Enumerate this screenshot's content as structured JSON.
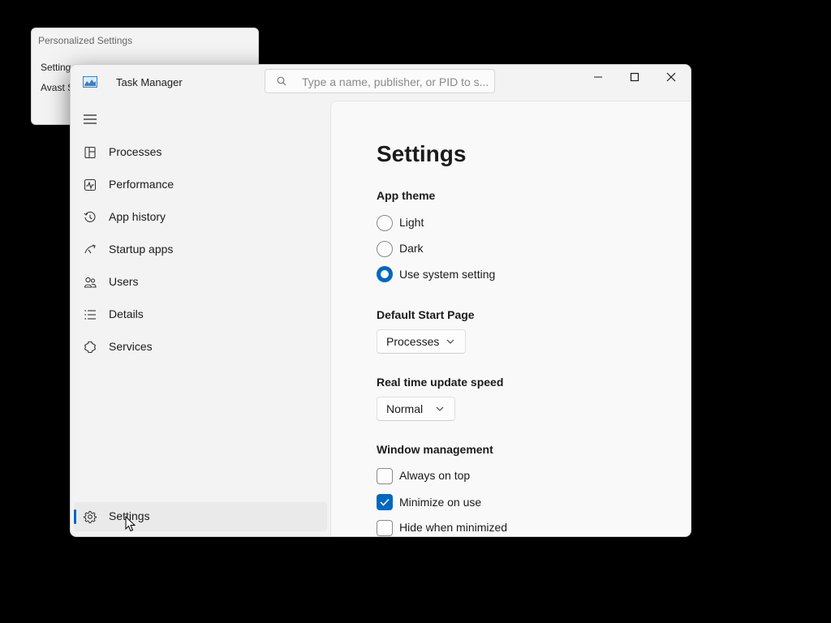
{
  "background_window": {
    "title": "Personalized Settings",
    "line1": "Setting r",
    "line2": "Avast S"
  },
  "window": {
    "title": "Task Manager",
    "search_placeholder": "Type a name, publisher, or PID to s..."
  },
  "sidebar": {
    "items": [
      {
        "label": "Processes",
        "icon": "processes-icon"
      },
      {
        "label": "Performance",
        "icon": "performance-icon"
      },
      {
        "label": "App history",
        "icon": "history-icon"
      },
      {
        "label": "Startup apps",
        "icon": "startup-icon"
      },
      {
        "label": "Users",
        "icon": "users-icon"
      },
      {
        "label": "Details",
        "icon": "details-icon"
      },
      {
        "label": "Services",
        "icon": "services-icon"
      }
    ],
    "settings_label": "Settings"
  },
  "settings": {
    "title": "Settings",
    "app_theme": {
      "heading": "App theme",
      "options": [
        "Light",
        "Dark",
        "Use system setting"
      ],
      "selected": "Use system setting"
    },
    "default_start_page": {
      "heading": "Default Start Page",
      "value": "Processes"
    },
    "update_speed": {
      "heading": "Real time update speed",
      "value": "Normal"
    },
    "window_management": {
      "heading": "Window management",
      "options": [
        {
          "label": "Always on top",
          "checked": false
        },
        {
          "label": "Minimize on use",
          "checked": true
        },
        {
          "label": "Hide when minimized",
          "checked": false
        }
      ]
    }
  },
  "colors": {
    "accent": "#0067c0",
    "sidebar_bg": "#f3f3f3",
    "content_bg": "#f9f9f9"
  }
}
